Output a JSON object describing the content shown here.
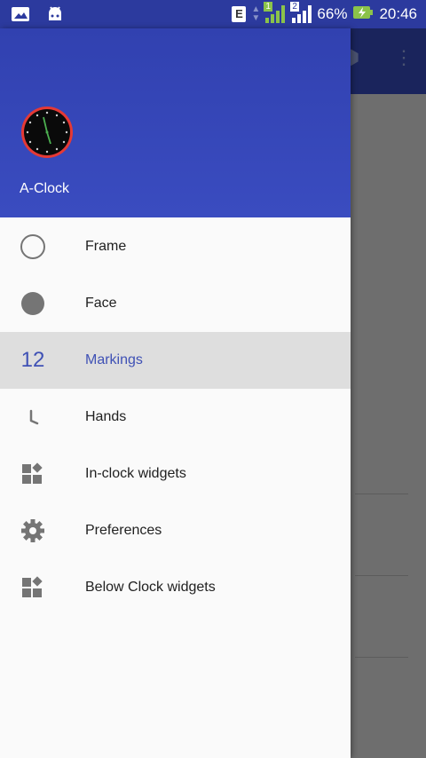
{
  "status_bar": {
    "network_label": "E",
    "sim1": "1",
    "sim2": "2",
    "battery": "66%",
    "time": "20:46"
  },
  "drawer": {
    "app_name": "A-Clock",
    "items": [
      {
        "label": "Frame",
        "icon": "circle-outline-icon",
        "active": false
      },
      {
        "label": "Face",
        "icon": "filled-circle-icon",
        "active": false
      },
      {
        "label": "Markings",
        "icon": "numbers-icon",
        "icon_text": "12",
        "active": true
      },
      {
        "label": "Hands",
        "icon": "clock-hand-icon",
        "active": false
      },
      {
        "label": "In-clock widgets",
        "icon": "widgets-icon",
        "active": false
      },
      {
        "label": "Preferences",
        "icon": "gear-icon",
        "active": false
      },
      {
        "label": "Below Clock widgets",
        "icon": "widgets-icon",
        "active": false
      }
    ]
  },
  "colors": {
    "header": "#3141b0",
    "accent": "#3f51b5",
    "active_bg": "#dedede"
  }
}
